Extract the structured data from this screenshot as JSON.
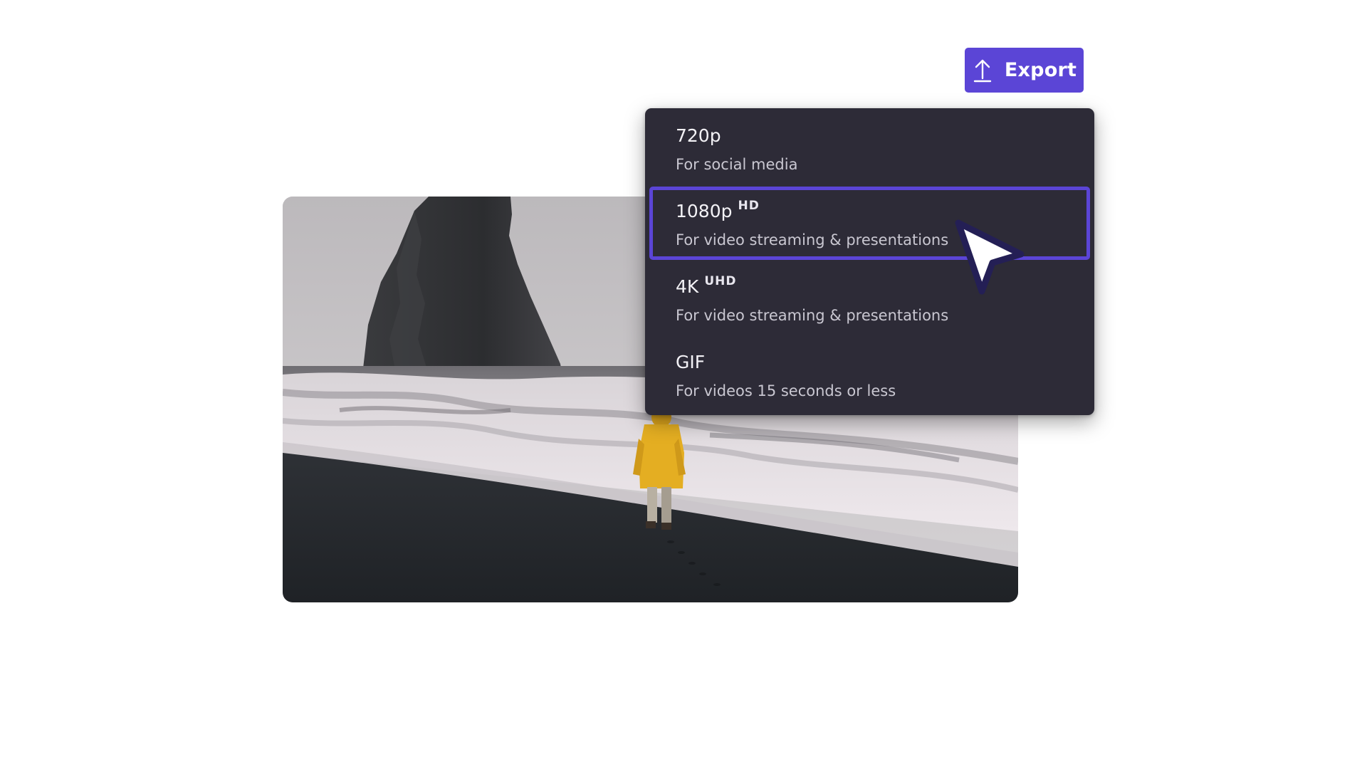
{
  "export_button": {
    "label": "Export",
    "icon": "upload-arrow-icon",
    "color": "#5b45d6"
  },
  "export_menu": {
    "items": [
      {
        "title": "720p",
        "badge": "",
        "description": "For social media",
        "selected": false
      },
      {
        "title": "1080p",
        "badge": "HD",
        "description": "For video streaming & presentations",
        "selected": true
      },
      {
        "title": "4K",
        "badge": "UHD",
        "description": "For video streaming & presentations",
        "selected": false
      },
      {
        "title": "GIF",
        "badge": "",
        "description": "For videos 15 seconds or less",
        "selected": false
      }
    ],
    "background": "#2d2b37",
    "selection_color": "#5b45d6"
  },
  "cursor": {
    "icon": "mouse-pointer-icon"
  }
}
